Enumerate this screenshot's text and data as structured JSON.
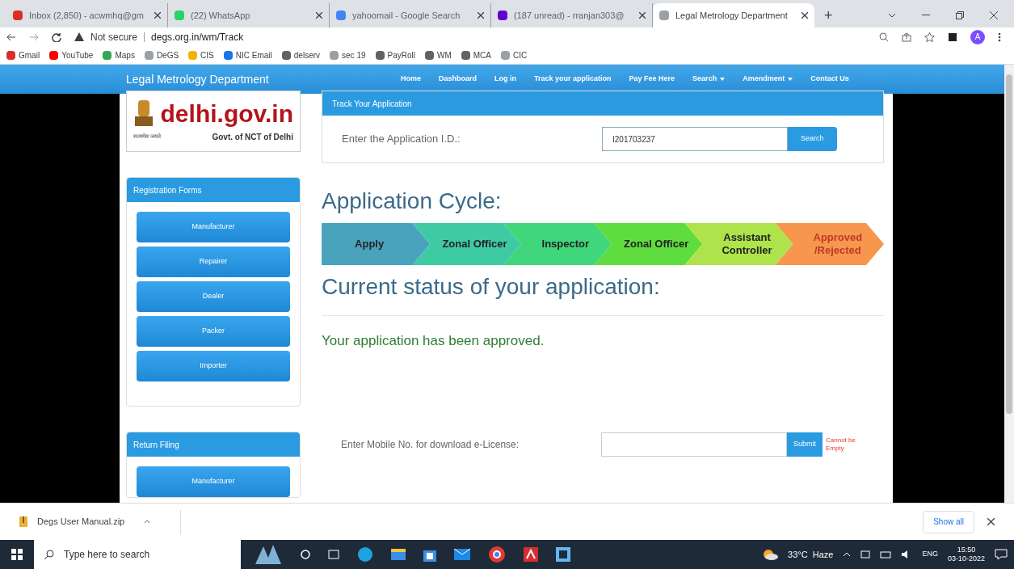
{
  "browser": {
    "tabs": [
      {
        "title": "Inbox (2,850) - acwmhq@gm",
        "selected": false,
        "color": "#d93025"
      },
      {
        "title": "(22) WhatsApp",
        "selected": false,
        "color": "#25d366"
      },
      {
        "title": "yahoomail - Google Search",
        "selected": false,
        "color": "#4285f4"
      },
      {
        "title": "(187 unread) - rranjan303@",
        "selected": false,
        "color": "#6001d2"
      },
      {
        "title": "Legal Metrology Department",
        "selected": true,
        "color": "#9aa0a6"
      }
    ],
    "new_tab": "+",
    "security": "Not secure",
    "url": "degs.org.in/wm/Track",
    "profile": "A",
    "bookmarks": [
      {
        "label": "Gmail",
        "color": "#d93025"
      },
      {
        "label": "YouTube",
        "color": "#ff0000"
      },
      {
        "label": "Maps",
        "color": "#34a853"
      },
      {
        "label": "DeGS",
        "color": "#9aa0a6"
      },
      {
        "label": "CIS",
        "color": "#f2b400"
      },
      {
        "label": "NIC Email",
        "color": "#1a73e8"
      },
      {
        "label": "delserv",
        "color": "#5f6368"
      },
      {
        "label": "sec 19",
        "color": "#9aa0a6"
      },
      {
        "label": "PayRoll",
        "color": "#5f6368"
      },
      {
        "label": "WM",
        "color": "#5f6368"
      },
      {
        "label": "MCA",
        "color": "#5f6368"
      },
      {
        "label": "CIC",
        "color": "#9aa0a6"
      }
    ]
  },
  "navbar": {
    "brand": "Legal Metrology Department",
    "links": [
      {
        "label": "Home",
        "dropdown": false
      },
      {
        "label": "Dashboard",
        "dropdown": false
      },
      {
        "label": "Log in",
        "dropdown": false
      },
      {
        "label": "Track your application",
        "dropdown": false
      },
      {
        "label": "Pay Fee Here",
        "dropdown": false
      },
      {
        "label": "Search",
        "dropdown": true
      },
      {
        "label": "Amendment",
        "dropdown": true
      },
      {
        "label": "Contact Us",
        "dropdown": false
      }
    ]
  },
  "logo": {
    "title": "delhi.gov.in",
    "motto": "सत्यमेव जयते",
    "subtitle": "Govt. of NCT of Delhi"
  },
  "sidebar": [
    {
      "heading": "Registration Forms",
      "buttons": [
        "Manufacturer",
        "Repairer",
        "Dealer",
        "Packer",
        "Importer"
      ]
    },
    {
      "heading": "Return Filing",
      "buttons": [
        "Manufacturer"
      ]
    }
  ],
  "track": {
    "heading": "Track Your Application",
    "label": "Enter the Application I.D.:",
    "value": "I201703237",
    "button": "Search"
  },
  "cycle": {
    "heading": "Application Cycle:",
    "steps": [
      {
        "label": "Apply",
        "color": "#4aa3bd"
      },
      {
        "label": "Zonal Officer",
        "color": "#3ecba4"
      },
      {
        "label": "Inspector",
        "color": "#3fd67c"
      },
      {
        "label": "Zonal Officer",
        "color": "#5fdc3e"
      },
      {
        "label": "Assistant Controller",
        "color": "#aee34c"
      },
      {
        "label": "Approved /Rejected",
        "color": "#f7964d"
      }
    ]
  },
  "status": {
    "heading": "Current status of your application:",
    "message": "Your application has been approved."
  },
  "download": {
    "label": "Enter Mobile No. for download e-License:",
    "button": "Submit",
    "error": "Cannot be Empty"
  },
  "download_bar": {
    "file": "Degs User Manual.zip",
    "show_all": "Show all"
  },
  "taskbar": {
    "search": "Type here to search",
    "weather": "33°C  Haze",
    "language": "ENG",
    "time": "15:50",
    "date": "03-10-2022"
  }
}
